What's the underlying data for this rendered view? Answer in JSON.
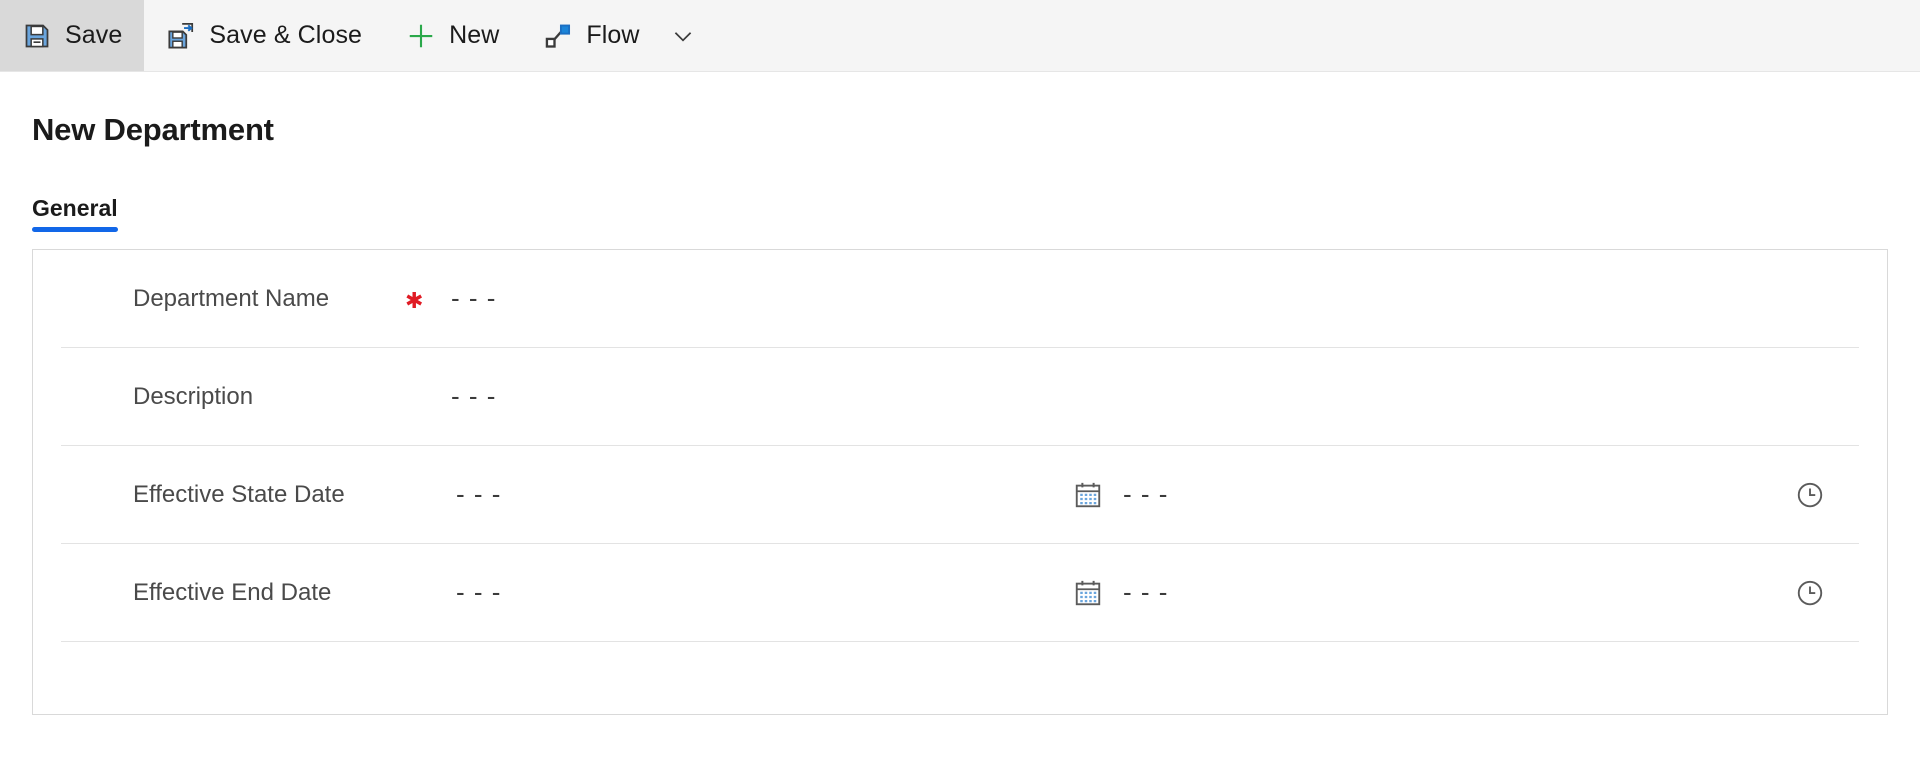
{
  "commandbar": {
    "buttons": [
      {
        "label": "Save",
        "icon": "save-icon",
        "active": true
      },
      {
        "label": "Save & Close",
        "icon": "save-close-icon",
        "active": false
      },
      {
        "label": "New",
        "icon": "plus-icon",
        "active": false
      },
      {
        "label": "Flow",
        "icon": "flow-icon",
        "active": false
      }
    ],
    "overflow_icon": "chevron-down-icon"
  },
  "header": {
    "title": "New Department"
  },
  "tabs": [
    {
      "label": "General",
      "selected": true
    }
  ],
  "form": {
    "rows": [
      {
        "label": "Department Name",
        "required": true,
        "value": "- - -"
      },
      {
        "label": "Description",
        "required": false,
        "value": "- - -"
      },
      {
        "label": "Effective State Date",
        "required": false,
        "date_value": "- - -",
        "date_icon": "calendar-icon",
        "time_value": "- - -",
        "time_icon": "clock-icon"
      },
      {
        "label": "Effective End Date",
        "required": false,
        "date_value": "- - -",
        "date_icon": "calendar-icon",
        "time_value": "- - -",
        "time_icon": "clock-icon"
      }
    ]
  },
  "colors": {
    "accent_blue": "#1267e8",
    "icon_blue": "#6aa5dd",
    "icon_dark": "#3b3b3b",
    "plus_green": "#28a745",
    "required_red": "#e01b24",
    "commandbar_bg": "#f5f5f5",
    "active_btn_bg": "#d9d9d9"
  }
}
